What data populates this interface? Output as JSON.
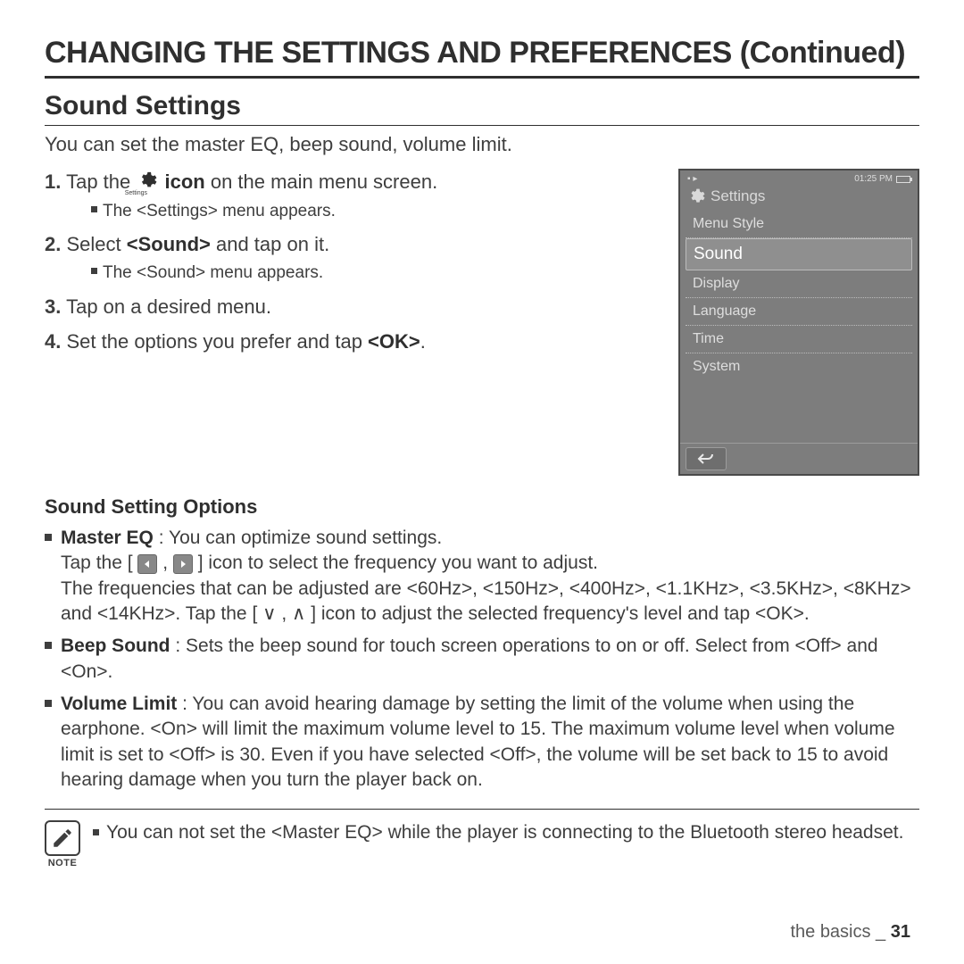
{
  "title": "CHANGING THE SETTINGS AND PREFERENCES (Continued)",
  "section_title": "Sound Settings",
  "intro": "You can set the master EQ, beep sound, volume limit.",
  "steps": {
    "s1_pre": "Tap the ",
    "s1_post": "icon",
    "s1_tail": " on the main menu screen.",
    "s1_sub": "The <Settings> menu appears.",
    "s2_pre": "Select ",
    "s2_bold": "<Sound>",
    "s2_post": " and tap on it.",
    "s2_sub": "The <Sound> menu appears.",
    "s3": "Tap on a desired menu.",
    "s4_pre": "Set the options you prefer and tap ",
    "s4_bold": "<OK>",
    "s4_post": "."
  },
  "gear_caption": "Settings",
  "device": {
    "time": "01:25 PM",
    "header": "Settings",
    "items": [
      "Menu Style",
      "Sound",
      "Display",
      "Language",
      "Time",
      "System"
    ],
    "selected_index": 1
  },
  "options_title": "Sound Setting Options",
  "options": {
    "master_label": "Master EQ",
    "master_head": " : You can optimize sound settings.",
    "master_body1a": "Tap the [ ",
    "master_body1b": " , ",
    "master_body1c": " ] icon to select the frequency you want to adjust.",
    "master_body2": "The frequencies that can be adjusted are <60Hz>, <150Hz>, <400Hz>, <1.1KHz>, <3.5KHz>, <8KHz> and <14KHz>. Tap the [ ∨ , ∧ ] icon to adjust the selected frequency's level and tap <OK>.",
    "beep_label": "Beep Sound",
    "beep_body": " : Sets the beep sound for touch screen operations to on or off. Select from <Off> and <On>.",
    "vol_label": "Volume Limit",
    "vol_body": " : You can avoid hearing damage by setting the limit of the volume when using the earphone. <On> will limit the maximum volume level to 15. The maximum volume level when volume limit is set to <Off> is 30. Even if you have selected <Off>, the volume will be set back to 15 to avoid hearing damage when you turn the player back on."
  },
  "note": {
    "label": "NOTE",
    "body": "You can not set the <Master EQ> while the player is connecting to the Bluetooth stereo headset."
  },
  "footer": {
    "section": "the basics _ ",
    "page": "31"
  }
}
